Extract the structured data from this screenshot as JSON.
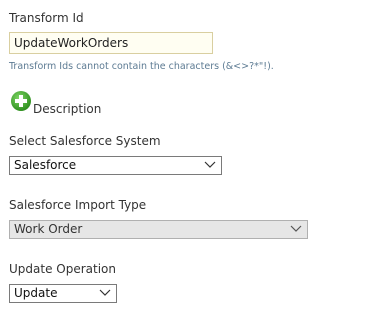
{
  "transform": {
    "label": "Transform Id",
    "value": "UpdateWorkOrders",
    "hint": "Transform Ids cannot contain the characters (&<>?*\"!)."
  },
  "description": {
    "label": "Description",
    "add_icon": "add-circle-icon",
    "accent_color": "#3ea02a"
  },
  "system": {
    "label": "Select Salesforce System",
    "selected": "Salesforce"
  },
  "import_type": {
    "label": "Salesforce Import Type",
    "selected": "Work Order"
  },
  "operation": {
    "label": "Update Operation",
    "selected": "Update"
  }
}
